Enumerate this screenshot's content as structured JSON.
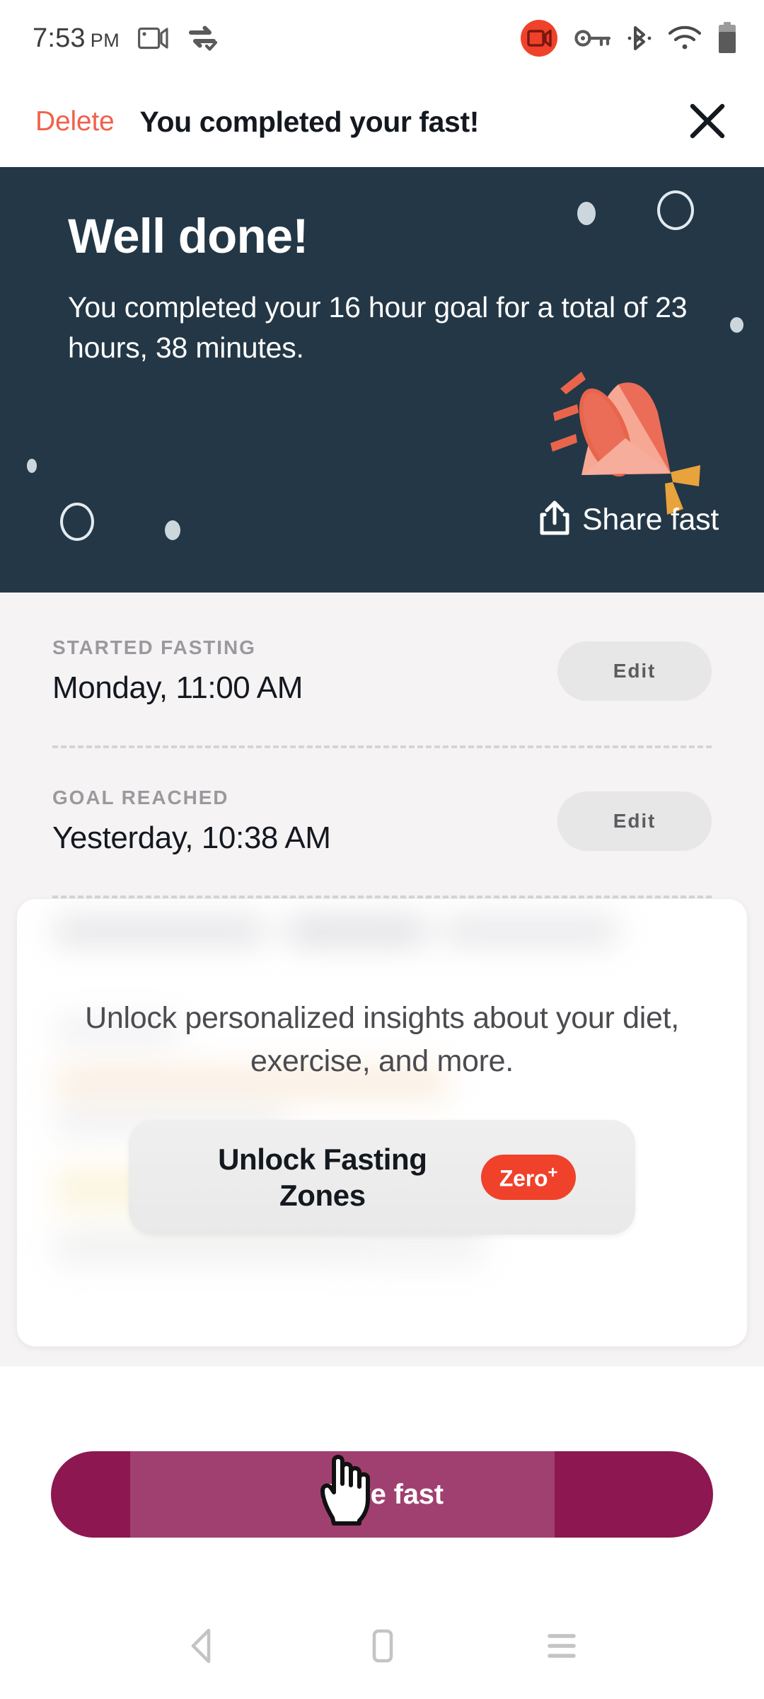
{
  "status_bar": {
    "time": "7:53",
    "ampm": "PM",
    "icons": [
      "screen-record-icon",
      "data-saver-icon",
      "screen-recording-active-icon",
      "vpn-key-icon",
      "bluetooth-icon",
      "wifi-icon",
      "battery-icon"
    ],
    "record_badge_color": "#F0412B"
  },
  "app_bar": {
    "delete_label": "Delete",
    "title": "You completed your fast!",
    "close_icon": "close-icon",
    "delete_color": "#F0614B"
  },
  "hero": {
    "background_color": "#233746",
    "title": "Well done!",
    "subtitle": "You completed your 16 hour goal for a total of 23 hours, 38 minutes.",
    "share_label": "Share fast",
    "share_icon": "share-icon",
    "illustration": "party-popper-icon",
    "goal_hours": 16,
    "total_hours": 23,
    "total_minutes": 38
  },
  "details": {
    "rows": [
      {
        "label": "Started fasting",
        "value": "Monday, 11:00 AM",
        "action": "Edit"
      },
      {
        "label": "Goal reached",
        "value": "Yesterday, 10:38 AM",
        "action": "Edit"
      }
    ]
  },
  "locked_card": {
    "message": "Unlock personalized insights about your diet, exercise, and more.",
    "unlock_label": "Unlock Fasting Zones",
    "badge_text": "Zero",
    "badge_plus": "+",
    "badge_color": "#F0412B"
  },
  "save": {
    "label": "Save fast",
    "button_color": "#8C1751"
  },
  "nav_bar": {
    "back_icon": "back-triangle-icon",
    "home_icon": "home-square-icon",
    "recents_icon": "recents-menu-icon"
  },
  "cursor": {
    "type": "pointing-hand-cursor"
  }
}
